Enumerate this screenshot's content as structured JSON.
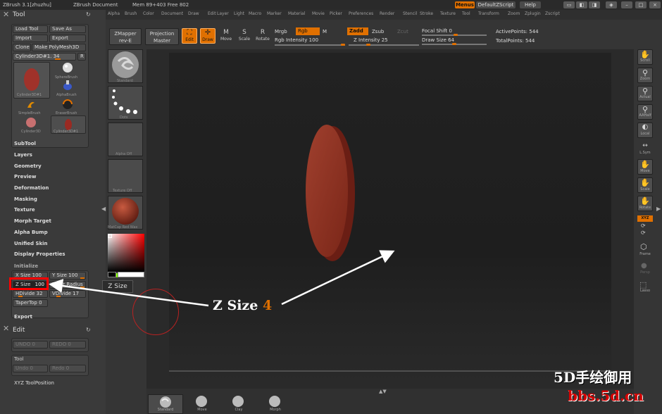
{
  "app": {
    "title": "ZBrush   3.1[zhuzhu]",
    "document": "ZBrush Document",
    "mem": "Mem 89+403 Free 802"
  },
  "titlebar_right": {
    "menus": "Menus",
    "script": "DefaultZScript",
    "help": "Help"
  },
  "menubar": [
    "Alpha",
    "Brush",
    "Color",
    "Document",
    "Draw",
    "Edit",
    "Layer",
    "Light",
    "Macro",
    "Marker",
    "Material",
    "Movie",
    "Picker",
    "Preferences",
    "Render",
    "Stencil",
    "Stroke",
    "Texture",
    "Tool",
    "Transform",
    "Zoom",
    "Zplugin",
    "Zscript"
  ],
  "tool": {
    "title": "Tool",
    "load": "Load Tool",
    "save_as": "Save As",
    "import": "Import",
    "export": "Export",
    "clone": "Clone",
    "make_polymesh": "Make PolyMesh3D",
    "current": "Cylinder3D#1. 34",
    "r": "R",
    "brushes": [
      {
        "label": "Cylinder3D#1"
      },
      {
        "label": "SphereBrush"
      },
      {
        "label": "AlphaBrush"
      },
      {
        "label": "SimpleBrush"
      },
      {
        "label": "EraserBrush"
      },
      {
        "label": "Cylinder3D"
      },
      {
        "label": "Cylinder3D#1"
      }
    ],
    "sections": [
      "SubTool",
      "Layers",
      "Geometry",
      "Preview",
      "Deformation",
      "Masking",
      "Texture",
      "Morph Target",
      "Alpha Bump",
      "Unified Skin",
      "Display Properties"
    ],
    "initialize": "Initialize",
    "x_size": "X Size 100",
    "y_size": "Y Size 100",
    "z_size_label": "Z Size",
    "z_size_input": "100",
    "inner_radius": "Inner Radius",
    "hdivide": "HDivide 32",
    "vdivide": "VDivide 17",
    "tapertop": "TaperTop 0",
    "export_label": "Export"
  },
  "edit": {
    "title": "Edit",
    "undo": "UNDO 0",
    "redo": "REDO 0"
  },
  "tool2": {
    "title": "Tool",
    "undo": "Undo 0",
    "redo": "Redo 0"
  },
  "xyz": "XYZ ToolPosition",
  "toolbar": {
    "zmapper": "ZMapper",
    "zmapper2": "rev-E",
    "projection": "Projection",
    "projection2": "Master",
    "edit": "Edit",
    "draw": "Draw",
    "move": "Move",
    "scale": "Scale",
    "rotate": "Rotate",
    "mrgb": "Mrgb",
    "rgb": "Rgb",
    "m": "M",
    "rgb_intensity": "Rgb Intensity 100",
    "zadd": "Zadd",
    "zsub": "Zsub",
    "zcut": "Zcut",
    "z_intensity": "Z Intensity 25",
    "focal_shift": "Focal Shift 0",
    "draw_size": "Draw Size 64",
    "active_points": "ActivePoints: 544",
    "total_points": "TotalPoints: 544"
  },
  "materials": [
    {
      "label": "Standard"
    },
    {
      "label": "Dots"
    },
    {
      "label": "Alpha Off"
    },
    {
      "label": "Texture Off"
    },
    {
      "label": "MatCap Red Wax"
    }
  ],
  "colors": {
    "accent": "#e07000",
    "red": "#8f2a1e",
    "highlight": "#ff0000"
  },
  "switch_color": "SwitchColor",
  "tooltip": "Z Size",
  "annotation": {
    "text": "Z Size",
    "value": "4"
  },
  "right_shelf": [
    {
      "label": "Scroll"
    },
    {
      "label": "Zoom"
    },
    {
      "label": "Actual"
    },
    {
      "label": "AAHalf"
    },
    {
      "label": "Local"
    },
    {
      "label": "L.Sym"
    },
    {
      "label": "Move"
    },
    {
      "label": "Scale"
    },
    {
      "label": "Rotate"
    },
    {
      "label": "XYZ"
    },
    {
      "label": "Frame"
    },
    {
      "label": "Persp"
    },
    {
      "label": "Lasso"
    }
  ],
  "bottom": [
    {
      "label": "Standard"
    },
    {
      "label": "Move"
    },
    {
      "label": "Clay"
    },
    {
      "label": "Morph"
    }
  ],
  "watermark": {
    "line1": "5D手绘御用",
    "line2": "bbs.5d.cn"
  }
}
